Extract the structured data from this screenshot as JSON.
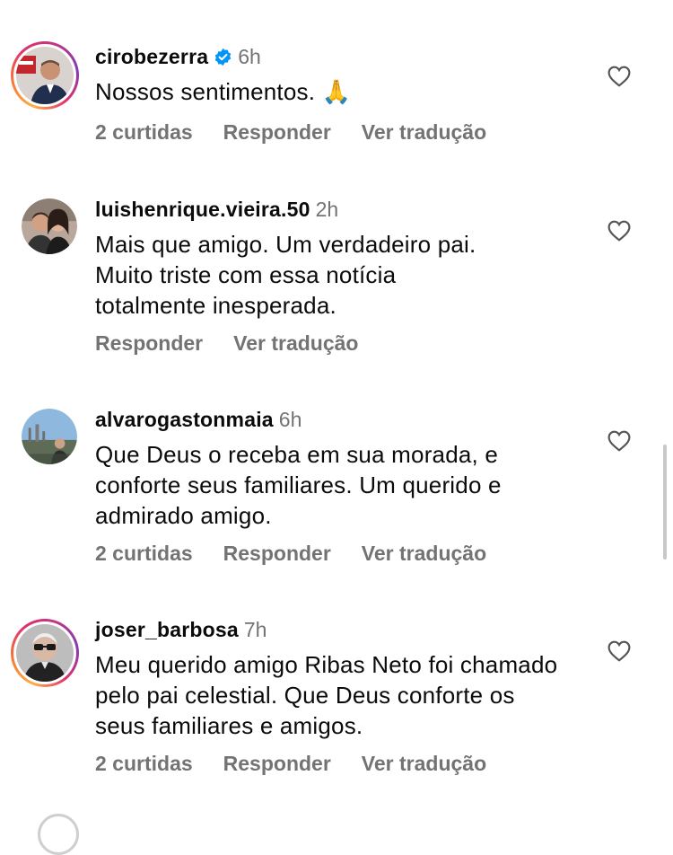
{
  "comments": [
    {
      "username": "cirobezerra",
      "verified": true,
      "time": "6h",
      "text": "Nossos sentimentos. 🙏",
      "likes": "2 curtidas",
      "reply": "Responder",
      "translate": "Ver tradução",
      "story_ring": true
    },
    {
      "username": "luishenrique.vieira.50",
      "verified": false,
      "time": "2h",
      "text": "Mais que amigo. Um verdadeiro pai. Muito triste com essa notícia totalmente inesperada.",
      "likes": "",
      "reply": "Responder",
      "translate": "Ver tradução",
      "story_ring": false
    },
    {
      "username": "alvarogastonmaia",
      "verified": false,
      "time": "6h",
      "text": "Que Deus o receba em sua morada, e conforte seus familiares. Um querido e admirado amigo.",
      "likes": "2 curtidas",
      "reply": "Responder",
      "translate": "Ver tradução",
      "story_ring": false
    },
    {
      "username": "joser_barbosa",
      "verified": false,
      "time": "7h",
      "text": "Meu querido amigo Ribas Neto foi chamado pelo pai celestial. Que Deus conforte os seus familiares e amigos.",
      "likes": "2 curtidas",
      "reply": "Responder",
      "translate": "Ver tradução",
      "story_ring": true
    }
  ],
  "icons": {
    "like": "heart-outline-icon",
    "verified": "verified-badge-icon"
  },
  "colors": {
    "text": "#0b0b0b",
    "muted": "#737373",
    "verified": "#0095f6"
  }
}
